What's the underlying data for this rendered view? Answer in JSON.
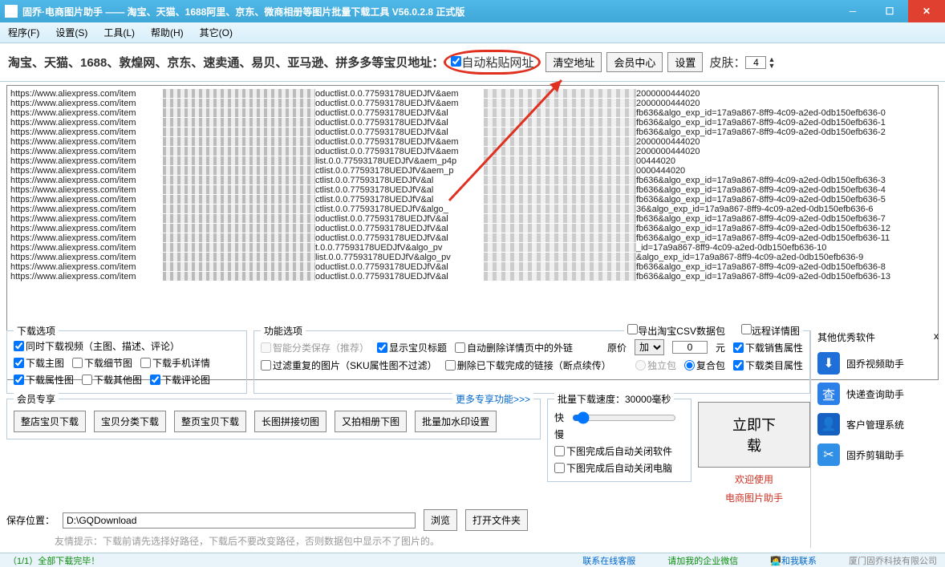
{
  "title": "固乔·电商图片助手 —— 淘宝、天猫、1688阿里、京东、微商相册等图片批量下载工具 V56.0.2.8 正式版",
  "menu": {
    "program": "程序(F)",
    "settings": "设置(S)",
    "tools": "工具(L)",
    "help": "帮助(H)",
    "other": "其它(O)"
  },
  "toolbar": {
    "label": "淘宝、天猫、1688、敦煌网、京东、速卖通、易贝、亚马逊、拼多多等宝贝地址：",
    "autopaste": "自动粘贴网址",
    "clear": "清空地址",
    "member": "会员中心",
    "set": "设置",
    "skin": "皮肤：",
    "skinval": "4"
  },
  "urls": [
    {
      "a": "https://www.aliexpress.com/item",
      "b": "oductlist.0.0.77593178UEDJfV&aem",
      "c": "2000000444020"
    },
    {
      "a": "https://www.aliexpress.com/item",
      "b": "oductlist.0.0.77593178UEDJfV&aem",
      "c": "2000000444020"
    },
    {
      "a": "https://www.aliexpress.com/item",
      "b": "oductlist.0.0.77593178UEDJfV&al",
      "c": "fb636&algo_exp_id=17a9a867-8ff9-4c09-a2ed-0db150efb636-0"
    },
    {
      "a": "https://www.aliexpress.com/item",
      "b": "oductlist.0.0.77593178UEDJfV&al",
      "c": "fb636&algo_exp_id=17a9a867-8ff9-4c09-a2ed-0db150efb636-1"
    },
    {
      "a": "https://www.aliexpress.com/item",
      "b": "oductlist.0.0.77593178UEDJfV&al",
      "c": "fb636&algo_exp_id=17a9a867-8ff9-4c09-a2ed-0db150efb636-2"
    },
    {
      "a": "https://www.aliexpress.com/item",
      "b": "oductlist.0.0.77593178UEDJfV&aem",
      "c": "2000000444020"
    },
    {
      "a": "https://www.aliexpress.com/item",
      "b": "oductlist.0.0.77593178UEDJfV&aem",
      "c": "2000000444020"
    },
    {
      "a": "https://www.aliexpress.com/item",
      "b": "list.0.0.77593178UEDJfV&aem_p4p",
      "c": "00444020"
    },
    {
      "a": "https://www.aliexpress.com/item",
      "b": "ctlist.0.0.77593178UEDJfV&aem_p",
      "c": "0000444020"
    },
    {
      "a": "https://www.aliexpress.com/item",
      "b": "ctlist.0.0.77593178UEDJfV&al",
      "c": "fb636&algo_exp_id=17a9a867-8ff9-4c09-a2ed-0db150efb636-3"
    },
    {
      "a": "https://www.aliexpress.com/item",
      "b": "ctlist.0.0.77593178UEDJfV&al",
      "c": "fb636&algo_exp_id=17a9a867-8ff9-4c09-a2ed-0db150efb636-4"
    },
    {
      "a": "https://www.aliexpress.com/item",
      "b": "ctlist.0.0.77593178UEDJfV&al",
      "c": "fb636&algo_exp_id=17a9a867-8ff9-4c09-a2ed-0db150efb636-5"
    },
    {
      "a": "https://www.aliexpress.com/item",
      "b": "ctlist.0.0.77593178UEDJfV&algo_",
      "c": "36&algo_exp_id=17a9a867-8ff9-4c09-a2ed-0db150efb636-6"
    },
    {
      "a": "https://www.aliexpress.com/item",
      "b": "oductlist.0.0.77593178UEDJfV&al",
      "c": "fb636&algo_exp_id=17a9a867-8ff9-4c09-a2ed-0db150efb636-7"
    },
    {
      "a": "https://www.aliexpress.com/item",
      "b": "oductlist.0.0.77593178UEDJfV&al",
      "c": "fb636&algo_exp_id=17a9a867-8ff9-4c09-a2ed-0db150efb636-12"
    },
    {
      "a": "https://www.aliexpress.com/item",
      "b": "oductlist.0.0.77593178UEDJfV&al",
      "c": "fb636&algo_exp_id=17a9a867-8ff9-4c09-a2ed-0db150efb636-11"
    },
    {
      "a": "https://www.aliexpress.com/item",
      "b": "t.0.0.77593178UEDJfV&algo_pv",
      "c": "_id=17a9a867-8ff9-4c09-a2ed-0db150efb636-10"
    },
    {
      "a": "https://www.aliexpress.com/item",
      "b": "list.0.0.77593178UEDJfV&algo_pv",
      "c": "&algo_exp_id=17a9a867-8ff9-4c09-a2ed-0db150efb636-9"
    },
    {
      "a": "https://www.aliexpress.com/item",
      "b": "oductlist.0.0.77593178UEDJfV&al",
      "c": "fb636&algo_exp_id=17a9a867-8ff9-4c09-a2ed-0db150efb636-8"
    },
    {
      "a": "https://www.aliexpress.com/item",
      "b": "oductlist.0.0.77593178UEDJfV&al",
      "c": "fb636&algo_exp_id=17a9a867-8ff9-4c09-a2ed-0db150efb636-13"
    }
  ],
  "dl": {
    "title": "下载选项",
    "video": "同时下载视频（主图、描述、评论）",
    "main": "下载主图",
    "detail": "下载细节图",
    "mobile": "下载手机详情",
    "attr": "下载属性图",
    "other": "下载其他图",
    "comment": "下载评论图"
  },
  "fn": {
    "title": "功能选项",
    "smart": "智能分类保存（推荐）",
    "showtitle": "显示宝贝标题",
    "autodel": "自动删除详情页中的外链",
    "filter": "过滤重复的图片（SKU属性图不过滤）",
    "delbroken": "删除已下载完成的链接（断点续传）"
  },
  "csv": "导出淘宝CSV数据包",
  "remote": "远程详情图",
  "price": {
    "label": "原价",
    "unit": "元",
    "val": "0",
    "sel": "加"
  },
  "sale": "下载销售属性",
  "pack": {
    "single": "独立包",
    "multi": "复合包"
  },
  "cat": "下载类目属性",
  "vip": {
    "title": "会员专享",
    "more": "更多专享功能>>>",
    "b1": "整店宝贝下载",
    "b2": "宝贝分类下载",
    "b3": "整页宝贝下载",
    "b4": "长图拼接切图",
    "b5": "又拍相册下图",
    "b6": "批量加水印设置"
  },
  "speed": {
    "label": "批量下载速度：30000毫秒",
    "fast": "快",
    "slow": "慢"
  },
  "go": "立即下载",
  "welcome": "欢迎使用",
  "appname": "电商图片助手",
  "autoclose": "下图完成后自动关闭软件",
  "autoshut": "下图完成后自动关闭电脑",
  "save": {
    "label": "保存位置：",
    "path": "D:\\GQDownload",
    "browse": "浏览",
    "open": "打开文件夹"
  },
  "tip": "友情提示：下载前请先选择好路径，下载后不要改变路径，否则数据包中显示不了图片的。",
  "other": {
    "title": "其他优秀软件",
    "i1": "固乔视频助手",
    "i2": "快递查询助手",
    "i3": "客户管理系统",
    "i4": "固乔剪辑助手"
  },
  "status": {
    "progress": "（1/1）全部下载完毕！",
    "cs": "联系在线客服",
    "wechat": "请加我的企业微信",
    "contact": "和我联系",
    "company": "厦门固乔科技有限公司"
  }
}
